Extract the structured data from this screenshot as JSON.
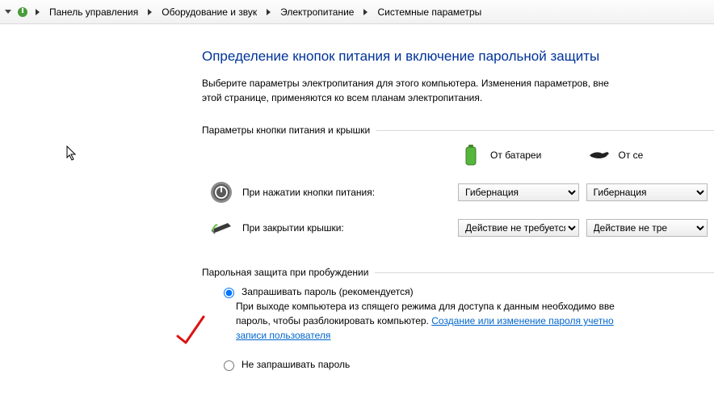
{
  "breadcrumb": {
    "items": [
      "Панель управления",
      "Оборудование и звук",
      "Электропитание",
      "Системные параметры"
    ]
  },
  "page": {
    "title": "Определение кнопок питания и включение парольной защиты",
    "desc_line1": "Выберите параметры электропитания для этого компьютера. Изменения параметров, вне",
    "desc_line2": "этой странице, применяются ко всем планам электропитания."
  },
  "section_power": {
    "header": "Параметры кнопки питания и крышки",
    "col_battery": "От батареи",
    "col_plugged": "От се",
    "rows": {
      "power_button": {
        "label": "При нажатии кнопки питания:",
        "battery_sel": "Гибернация",
        "plug_sel": "Гибернация"
      },
      "lid_close": {
        "label": "При закрытии крышки:",
        "battery_sel": "Действие не требуется",
        "plug_sel": "Действие не тре"
      }
    }
  },
  "section_password": {
    "header": "Парольная защита при пробуждении",
    "opt_require": "Запрашивать пароль (рекомендуется)",
    "opt_require_desc_a": "При выходе компьютера из спящего режима для доступа к данным необходимо вве",
    "opt_require_desc_b": "пароль, чтобы разблокировать компьютер. ",
    "link_a": "Создание или изменение пароля учетно",
    "link_b": "записи пользователя",
    "opt_norequire": "Не запрашивать пароль"
  }
}
